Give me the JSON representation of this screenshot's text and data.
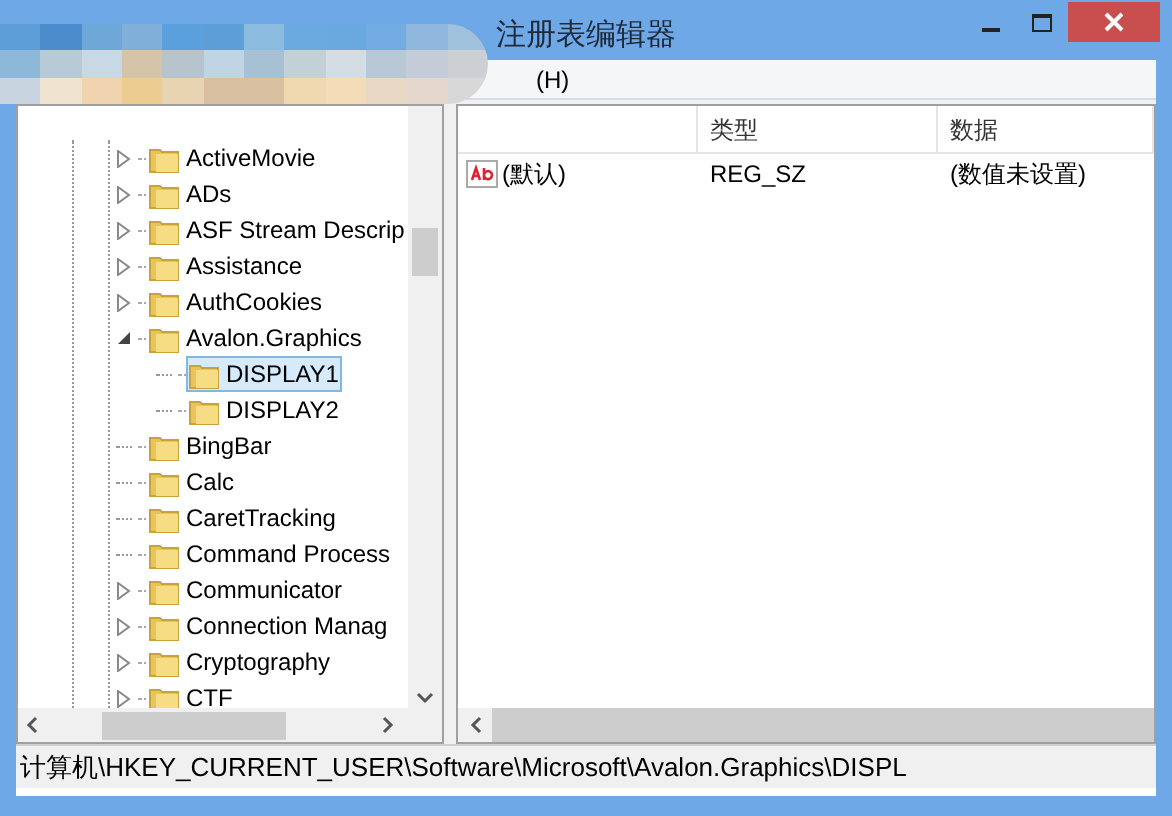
{
  "window": {
    "title": "注册表编辑器"
  },
  "menu": [
    {
      "label": "(H)"
    }
  ],
  "tree": [
    {
      "label": "ActiveMovie",
      "expandable": true,
      "expanded": false,
      "selected": false
    },
    {
      "label": "ADs",
      "expandable": true,
      "expanded": false,
      "selected": false
    },
    {
      "label": "ASF Stream Descrip",
      "expandable": true,
      "expanded": false,
      "selected": false
    },
    {
      "label": "Assistance",
      "expandable": true,
      "expanded": false,
      "selected": false
    },
    {
      "label": "AuthCookies",
      "expandable": true,
      "expanded": false,
      "selected": false
    },
    {
      "label": "Avalon.Graphics",
      "expandable": true,
      "expanded": true,
      "selected": false,
      "children": [
        {
          "label": "DISPLAY1",
          "expandable": false,
          "expanded": false,
          "selected": true
        },
        {
          "label": "DISPLAY2",
          "expandable": false,
          "expanded": false,
          "selected": false
        }
      ]
    },
    {
      "label": "BingBar",
      "expandable": false,
      "expanded": false,
      "selected": false
    },
    {
      "label": "Calc",
      "expandable": false,
      "expanded": false,
      "selected": false
    },
    {
      "label": "CaretTracking",
      "expandable": false,
      "expanded": false,
      "selected": false
    },
    {
      "label": "Command Process",
      "expandable": false,
      "expanded": false,
      "selected": false
    },
    {
      "label": "Communicator",
      "expandable": true,
      "expanded": false,
      "selected": false
    },
    {
      "label": "Connection Manag",
      "expandable": true,
      "expanded": false,
      "selected": false
    },
    {
      "label": "Cryptography",
      "expandable": true,
      "expanded": false,
      "selected": false
    },
    {
      "label": "CTF",
      "expandable": true,
      "expanded": false,
      "selected": false
    }
  ],
  "values_table": {
    "columns": [
      "类型",
      "数据"
    ],
    "rows": [
      {
        "name": "(默认)",
        "type": "REG_SZ",
        "data": "(数值未设置)"
      }
    ]
  },
  "status_bar": "计算机\\HKEY_CURRENT_USER\\Software\\Microsoft\\Avalon.Graphics\\DISPL"
}
